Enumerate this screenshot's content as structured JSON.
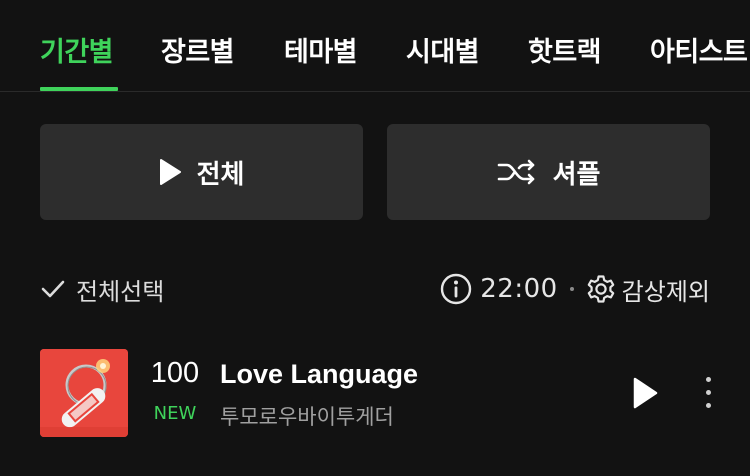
{
  "tabs": [
    {
      "label": "기간별",
      "active": true
    },
    {
      "label": "장르별",
      "active": false
    },
    {
      "label": "테마별",
      "active": false
    },
    {
      "label": "시대별",
      "active": false
    },
    {
      "label": "핫트랙",
      "active": false
    },
    {
      "label": "아티스트",
      "active": false
    }
  ],
  "actions": {
    "play_all_label": "전체",
    "shuffle_label": "셔플"
  },
  "toolbar": {
    "select_all_label": "전체선택",
    "timer_value": "22:00",
    "exclude_label": "감상제외"
  },
  "track": {
    "rank": "100",
    "badge": "NEW",
    "title": "Love Language",
    "artist": "투모로우바이투게더"
  },
  "colors": {
    "accent": "#3fd35b",
    "background": "#121212",
    "button_bg": "#2d2d2d",
    "album_red": "#e8423a"
  },
  "icons": {
    "play_all": "play-icon",
    "shuffle": "shuffle-icon",
    "select_all": "check-icon",
    "timer": "info-circle-icon",
    "exclude": "gear-icon",
    "track_play": "play-icon",
    "more": "more-vertical-icon"
  }
}
